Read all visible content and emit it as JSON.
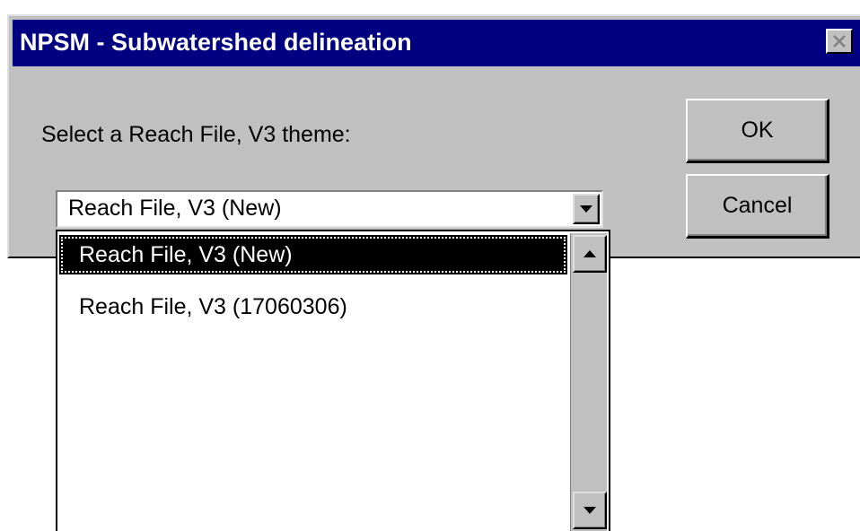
{
  "window": {
    "title": "NPSM - Subwatershed delineation",
    "close_icon": "close-x-icon"
  },
  "dialog": {
    "prompt": "Select a Reach File, V3 theme:",
    "ok_label": "OK",
    "cancel_label": "Cancel"
  },
  "combo": {
    "selected_value": "Reach File, V3 (New)",
    "dropdown_icon": "chevron-down-icon"
  },
  "list": {
    "items": [
      {
        "label": "Reach File, V3 (New)",
        "selected": true
      },
      {
        "label": "Reach File, V3 (17060306)",
        "selected": false
      }
    ]
  },
  "colors": {
    "titlebar": "#000080",
    "face": "#c0c0c0",
    "selection": "#000000"
  }
}
